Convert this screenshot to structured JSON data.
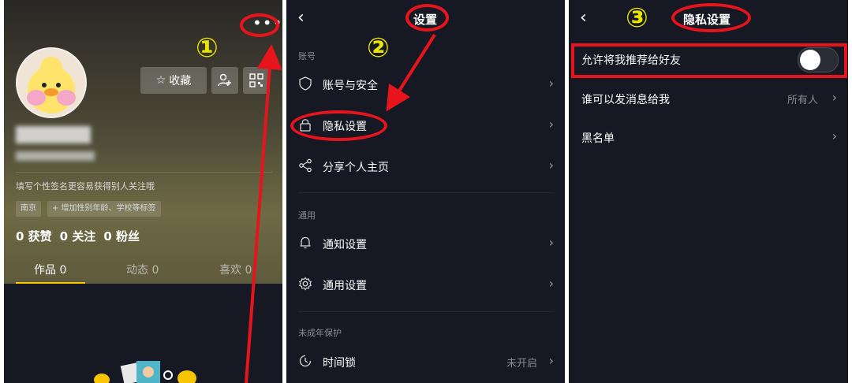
{
  "profile": {
    "favorite_label": "收藏",
    "signature": "填写个性签名更容易获得别人关注哦",
    "tags": [
      "南京",
      "+ 增加性别年龄、学校等标签"
    ],
    "stats": [
      "0 获赞",
      "0 关注",
      "0 粉丝"
    ],
    "tabs": [
      "作品 0",
      "动态 0",
      "喜欢 0"
    ],
    "more_label": "•••"
  },
  "settings": {
    "title": "设置",
    "sections": [
      {
        "label": "账号",
        "items": [
          {
            "label": "账号与安全",
            "icon": "shield-icon"
          },
          {
            "label": "隐私设置",
            "icon": "lock-icon"
          },
          {
            "label": "分享个人主页",
            "icon": "share-icon"
          }
        ]
      },
      {
        "label": "通用",
        "items": [
          {
            "label": "通知设置",
            "icon": "bell-icon"
          },
          {
            "label": "通用设置",
            "icon": "gear-icon"
          }
        ]
      },
      {
        "label": "未成年保护",
        "items": [
          {
            "label": "时间锁",
            "icon": "clock-icon",
            "value": "未开启"
          }
        ]
      }
    ]
  },
  "privacy": {
    "title": "隐私设置",
    "rows": [
      {
        "label": "允许将我推荐给好友",
        "toggle": false
      },
      {
        "label": "谁可以发消息给我",
        "value": "所有人"
      },
      {
        "label": "黑名单"
      }
    ]
  },
  "annotations": [
    "①",
    "②",
    "③"
  ],
  "colors": {
    "background": "#161823",
    "accent": "#f7c600",
    "highlight": "#e8141c",
    "step_number": "#e9e400"
  }
}
